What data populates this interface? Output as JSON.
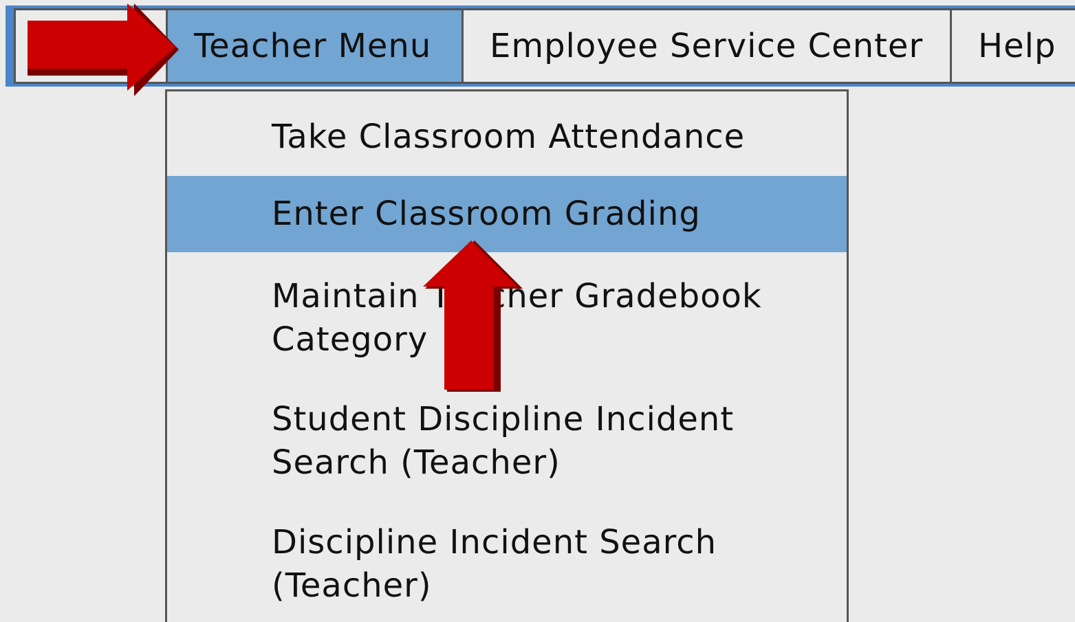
{
  "menubar": {
    "items": [
      {
        "label": "Teacher Menu",
        "active": true
      },
      {
        "label": "Employee Service Center",
        "active": false
      },
      {
        "label": "Help",
        "active": false
      }
    ]
  },
  "dropdown": {
    "items": [
      {
        "label": "Take Classroom Attendance",
        "highlighted": false
      },
      {
        "label": "Enter Classroom Grading",
        "highlighted": true
      },
      {
        "label": "Maintain Teacher Gradebook Category",
        "highlighted": false
      },
      {
        "label": "Student Discipline Incident Search (Teacher)",
        "highlighted": false
      },
      {
        "label": "Discipline Incident Search (Teacher)",
        "highlighted": false
      }
    ]
  },
  "annotations": {
    "arrow_color": "#cc0000",
    "arrows": [
      {
        "icon": "red-arrow-right-icon",
        "points_to": "Teacher Menu"
      },
      {
        "icon": "red-arrow-up-icon",
        "points_to": "Enter Classroom Grading"
      }
    ]
  },
  "colors": {
    "highlight": "#72a5d2",
    "menubar_border": "#4a86c8",
    "background": "#ebebeb"
  }
}
